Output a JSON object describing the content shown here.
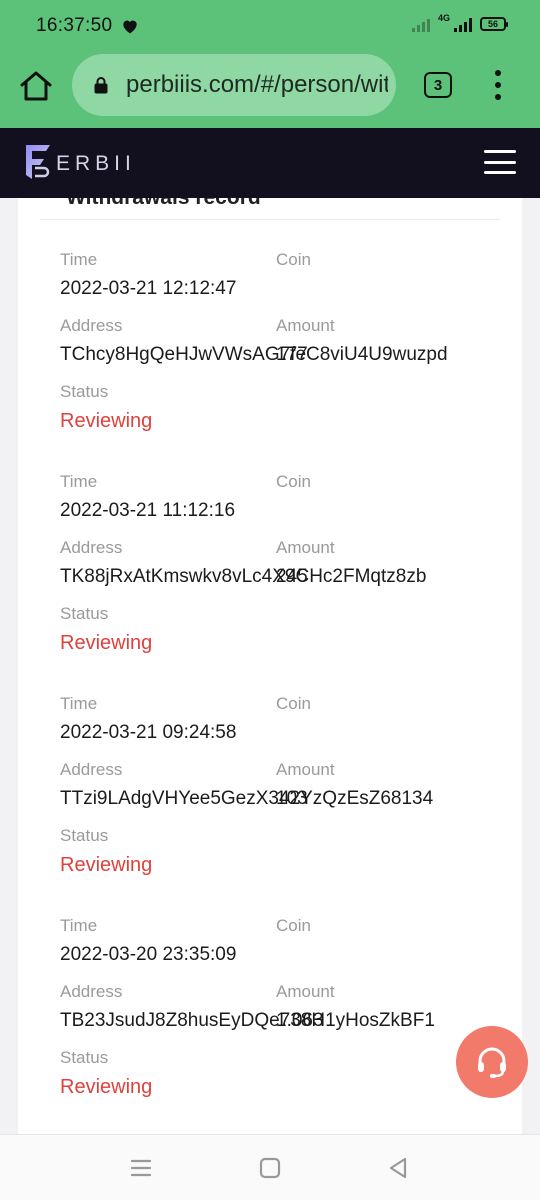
{
  "status_bar": {
    "time": "16:37:50",
    "network": "4G",
    "battery": "56"
  },
  "browser": {
    "url": "perbiiis.com/#/person/withdrawals",
    "tab_count": "3"
  },
  "site": {
    "logo_text": "ERBII"
  },
  "section": {
    "title": "Withdrawals record"
  },
  "labels": {
    "time": "Time",
    "coin": "Coin",
    "address": "Address",
    "amount": "Amount",
    "status": "Status"
  },
  "records": [
    {
      "time": "2022-03-21 12:12:47",
      "address": "TChcy8HgQeHJwVWsAG7feC8viU4U9wuzpd",
      "amount": "177",
      "status": "Reviewing"
    },
    {
      "time": "2022-03-21 11:12:16",
      "address": "TK88jRxAtKmswkv8vLc4X9CHc2FMqtz8zb",
      "amount": "245",
      "status": "Reviewing"
    },
    {
      "time": "2022-03-21 09:24:58",
      "address": "TTzi9LAdgVHYee5GezX342YzQzEsZ68134",
      "amount": "103",
      "status": "Reviewing"
    },
    {
      "time": "2022-03-20 23:35:09",
      "address": "TB23JsudJ8Z8husEyDQe738H1yHosZkBF1",
      "amount": "1.063",
      "status": "Reviewing"
    }
  ],
  "colors": {
    "browser_green": "#5cc27a",
    "header_dark": "#12101f",
    "status_red": "#e0413c",
    "support_button": "#f27a6b"
  }
}
